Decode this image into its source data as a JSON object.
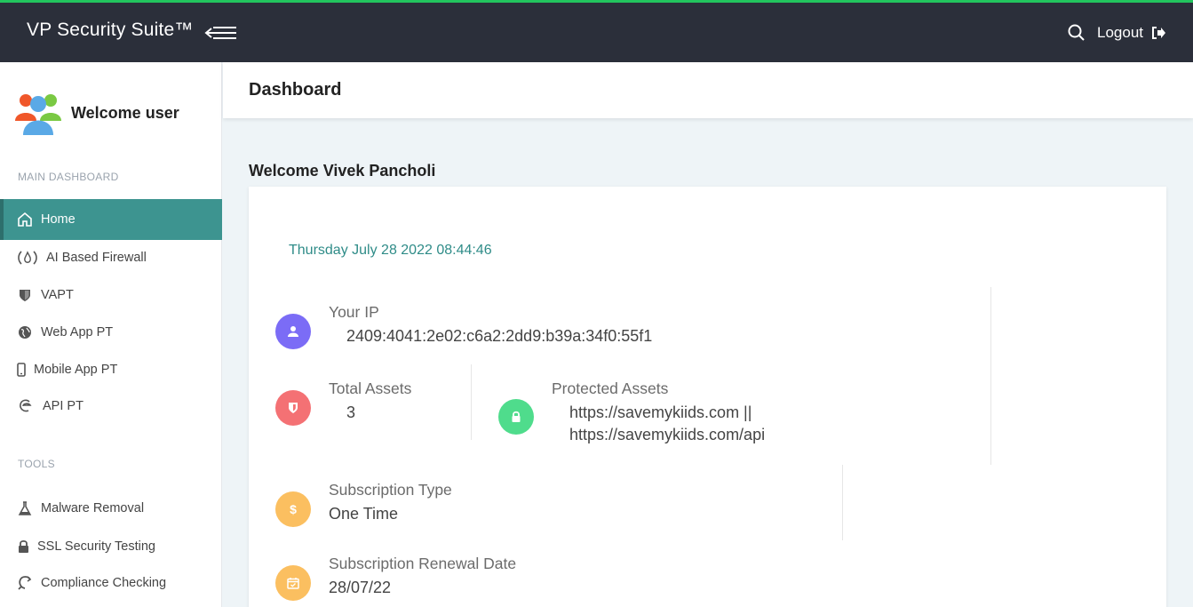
{
  "topbar": {
    "brand": "VP Security Suite™",
    "logout_label": "Logout"
  },
  "sidebar": {
    "welcome": "Welcome user",
    "main_section": "MAIN DASHBOARD",
    "main_items": [
      {
        "label": "Home",
        "icon": "home-icon",
        "active": true
      },
      {
        "label": "AI Based Firewall",
        "icon": "firewall-icon"
      },
      {
        "label": "VAPT",
        "icon": "shield-icon"
      },
      {
        "label": "Web App PT",
        "icon": "globe-icon"
      },
      {
        "label": "Mobile App PT",
        "icon": "mobile-icon"
      },
      {
        "label": "API PT",
        "icon": "api-icon"
      }
    ],
    "tools_section": "TOOLS",
    "tool_items": [
      {
        "label": "Malware Removal",
        "icon": "flask-icon"
      },
      {
        "label": "SSL Security Testing",
        "icon": "lock-icon"
      },
      {
        "label": "Compliance Checking",
        "icon": "refresh-icon"
      }
    ]
  },
  "header": {
    "title": "Dashboard"
  },
  "main": {
    "greeting": "Welcome Vivek Pancholi",
    "datetime": "Thursday July 28 2022 08:44:46",
    "ip": {
      "label": "Your IP",
      "value": "2409:4041:2e02:c6a2:2dd9:b39a:34f0:55f1"
    },
    "total_assets": {
      "label": "Total Assets",
      "value": "3"
    },
    "protected_assets": {
      "label": "Protected Assets",
      "value_line1": "https://savemykiids.com ||",
      "value_line2": "https://savemykiids.com/api"
    },
    "subscription_type": {
      "label": "Subscription Type",
      "value": "One Time"
    },
    "renewal_date": {
      "label": "Subscription Renewal Date",
      "value": "28/07/22"
    }
  },
  "colors": {
    "topbar": "#2b2f3a",
    "accent_top": "#22c55e",
    "active_nav": "#3d9490",
    "ip_circle": "#7b6cf6",
    "assets_circle": "#f47174",
    "protected_circle": "#4fdc8c",
    "subscription_circle": "#fbbf60",
    "renewal_circle": "#fbbf60"
  }
}
